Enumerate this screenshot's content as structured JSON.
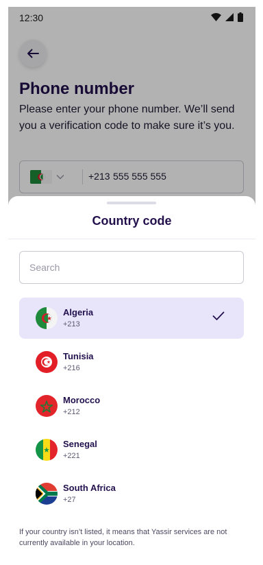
{
  "status_bar": {
    "time": "12:30"
  },
  "page": {
    "title": "Phone number",
    "description": "Please enter your phone number. We’ll send you a verification code to make sure it’s you.",
    "phone_field": {
      "dial_code": "+213",
      "value": "555 555 555"
    }
  },
  "sheet": {
    "title": "Country code",
    "search_placeholder": "Search",
    "countries": [
      {
        "name": "Algeria",
        "code": "+213",
        "selected": true
      },
      {
        "name": "Tunisia",
        "code": "+216",
        "selected": false
      },
      {
        "name": "Morocco",
        "code": "+212",
        "selected": false
      },
      {
        "name": "Senegal",
        "code": "+221",
        "selected": false
      },
      {
        "name": "South Africa",
        "code": "+27",
        "selected": false
      }
    ],
    "footnote": "If your country isn’t listed, it means that Yassir services are not currently available in your location."
  },
  "colors": {
    "accent": "#22104d",
    "selected_bg": "#e8e5fb"
  }
}
